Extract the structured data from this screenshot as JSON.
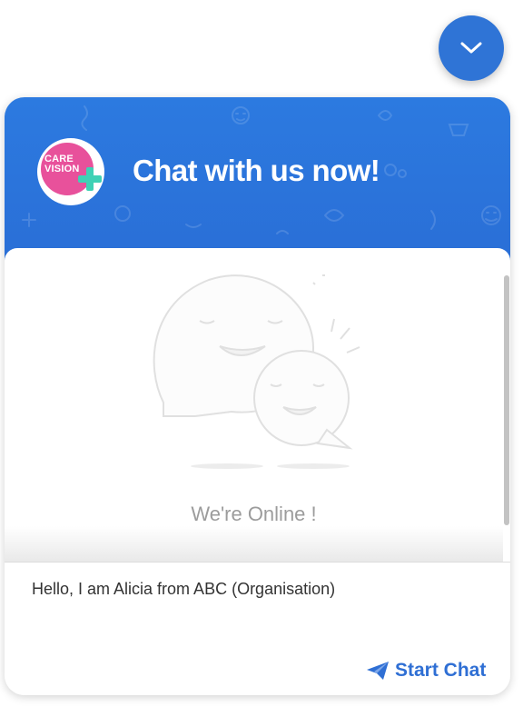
{
  "header": {
    "title": "Chat with us now!",
    "logo_text_line1": "CARE",
    "logo_text_line2": "VISION"
  },
  "body": {
    "status_text": "We're Online !"
  },
  "footer": {
    "message": "Hello, I am Alicia from ABC (Organisation)",
    "start_chat_label": "Start Chat"
  },
  "icons": {
    "toggle": "chevron-down-icon",
    "send": "paper-plane-icon",
    "illustration": "chat-bubbles-illustration"
  },
  "colors": {
    "header_blue": "#2c7ae0",
    "accent_blue": "#2f6fd4",
    "logo_pink": "#e8519b",
    "logo_plus_teal": "#3fd1b5",
    "status_gray": "#9c9c9c"
  }
}
